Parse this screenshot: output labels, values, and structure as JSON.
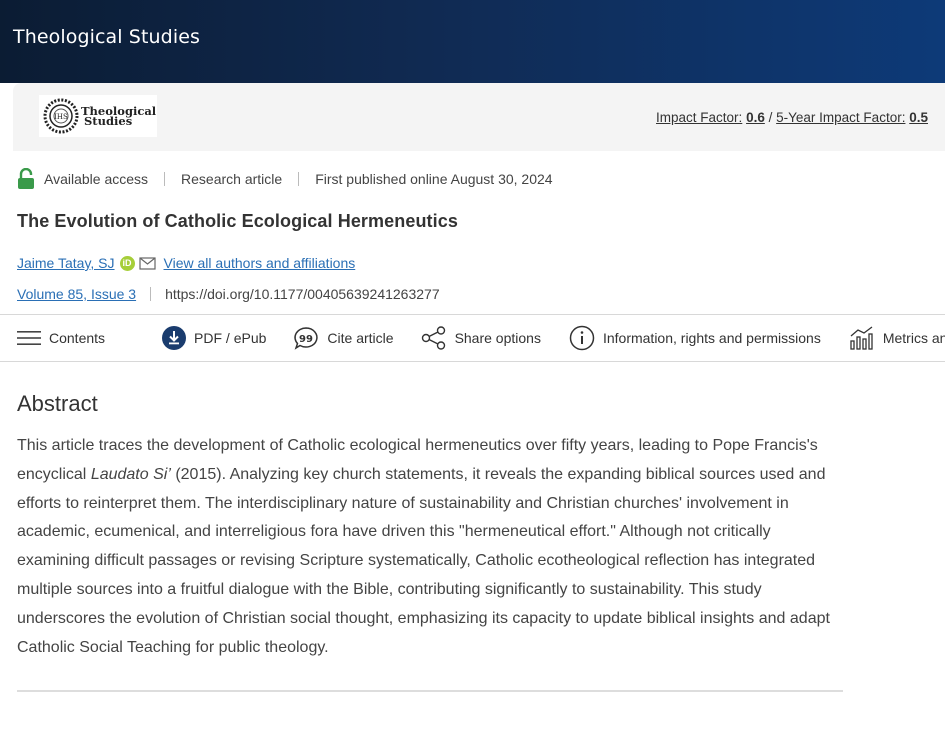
{
  "header": {
    "journal_name": "Theological Studies"
  },
  "banner": {
    "logo_text_line1": "Theological",
    "logo_text_line2": "Studies",
    "impact_factor_label": "Impact Factor:",
    "impact_factor_value": "0.6",
    "separator": "/",
    "five_year_label": "5-Year Impact Factor:",
    "five_year_value": "0.5"
  },
  "article_meta": {
    "access": "Available access",
    "type": "Research article",
    "published": "First published online August 30, 2024"
  },
  "article": {
    "title": "The Evolution of Catholic Ecological Hermeneutics",
    "author": "Jaime Tatay, SJ",
    "orcid_glyph": "iD",
    "all_authors_link": "View all authors and affiliations",
    "issue": "Volume 85, Issue 3",
    "doi": "https://doi.org/10.1177/00405639241263277"
  },
  "toolbar": {
    "contents": "Contents",
    "pdf": "PDF / ePub",
    "cite": "Cite article",
    "share": "Share options",
    "info": "Information, rights and permissions",
    "metrics": "Metrics and citations"
  },
  "abstract": {
    "heading": "Abstract",
    "part1": "This article traces the development of Catholic ecological hermeneutics over fifty years, leading to Pope Francis's encyclical ",
    "italic": "Laudato Si’",
    "part2": " (2015). Analyzing key church statements, it reveals the expanding biblical sources used and efforts to reinterpret them. The interdisciplinary nature of sustainability and Christian churches' involvement in academic, ecumenical, and interreligious fora have driven this \"hermeneutical effort.\" Although not critically examining difficult passages or revising Scripture systematically, Catholic ecotheological reflection has integrated multiple sources into a fruitful dialogue with the Bible, contributing significantly to sustainability. This study underscores the evolution of Christian social thought, emphasizing its capacity to update biblical insights and adapt Catholic Social Teaching for public theology."
  },
  "colors": {
    "header_bg": "#102a52",
    "link": "#2a6fb5",
    "lock_green": "#3a9a4a",
    "icon_navy": "#1a3c6e"
  }
}
